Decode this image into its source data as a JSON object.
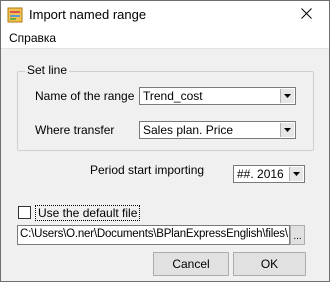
{
  "window": {
    "title": "Import named range",
    "icon": "import-range-icon"
  },
  "menu": {
    "items": [
      "Справка"
    ]
  },
  "group": {
    "legend": "Set line",
    "range_label": "Name of the range",
    "range_value": "Trend_cost",
    "transfer_label": "Where transfer",
    "transfer_value": "Sales plan. Price"
  },
  "period": {
    "label": "Period start importing",
    "value": "##. 2016"
  },
  "default_file": {
    "label": "Use the default file",
    "checked": false
  },
  "path": {
    "value": "C:\\Users\\O.ner\\Documents\\BPlanExpressEnglish\\files\\F",
    "browse_label": "..."
  },
  "buttons": {
    "cancel": "Cancel",
    "ok": "OK"
  }
}
